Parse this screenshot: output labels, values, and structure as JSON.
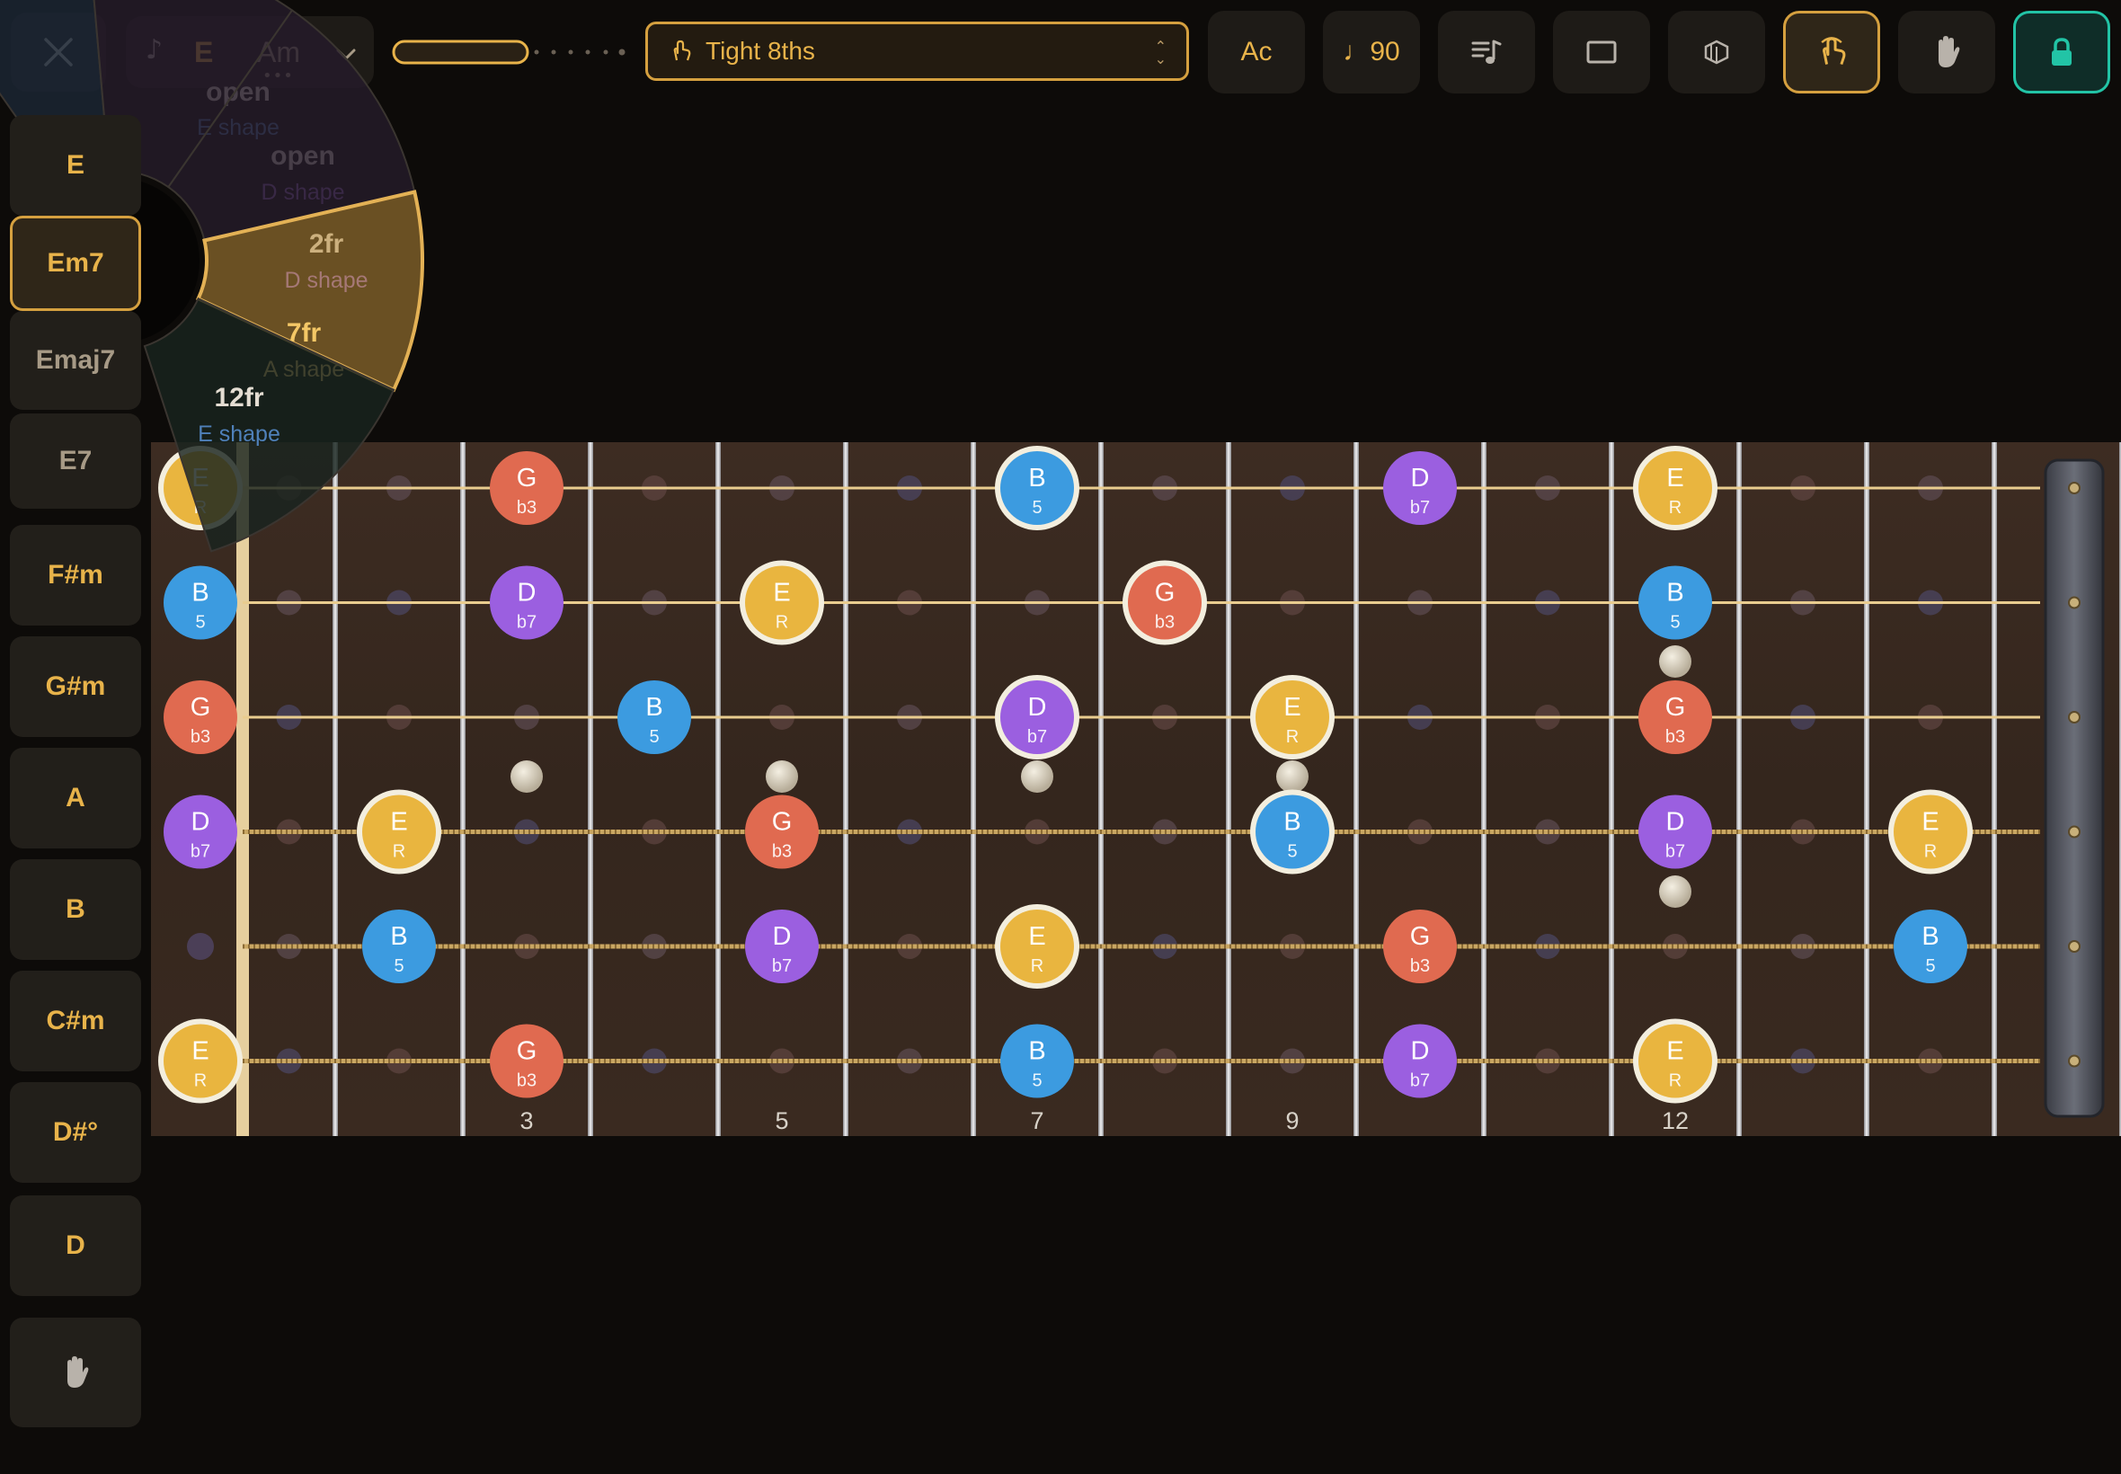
{
  "toolbar": {
    "close_icon": "close-icon",
    "key_note_icon": "music-note-icon",
    "key_root": "E",
    "key_alt": "Am",
    "key_more": "•••",
    "tempo_progress": 0.62,
    "pattern_label": "Tight 8ths",
    "pattern_icon": "tap-icon",
    "ac_label": "Ac",
    "bpm_label": "♩90",
    "buttons": [
      {
        "name": "notation-button",
        "icon": "notation-icon"
      },
      {
        "name": "frame-button",
        "icon": "frame-icon"
      },
      {
        "name": "layers-button",
        "icon": "layers-icon"
      },
      {
        "name": "tap-mode-button",
        "icon": "tap-icon",
        "active": true
      },
      {
        "name": "hand-mode-button",
        "icon": "hand-icon"
      },
      {
        "name": "lock-button",
        "icon": "lock-icon",
        "accent": "#22c4a6"
      }
    ]
  },
  "chords": [
    {
      "label": "E",
      "selected": false
    },
    {
      "label": "Em7",
      "selected": true
    },
    {
      "label": "Emaj7",
      "selected": false
    },
    {
      "label": "E7",
      "selected": false
    },
    {
      "label": "F#m",
      "selected": false
    },
    {
      "label": "G#m",
      "selected": false
    },
    {
      "label": "A",
      "selected": false
    },
    {
      "label": "B",
      "selected": false
    },
    {
      "label": "C#m",
      "selected": false
    },
    {
      "label": "D#°",
      "selected": false
    },
    {
      "label": "D",
      "selected": false
    }
  ],
  "chord_hand_icon": "hand-icon",
  "voicing_menu": [
    {
      "position": "open",
      "shape": "E shape",
      "selected": false
    },
    {
      "position": "open",
      "shape": "D shape",
      "selected": false
    },
    {
      "position": "2fr",
      "shape": "D shape",
      "selected": false
    },
    {
      "position": "7fr",
      "shape": "A shape",
      "selected": true
    },
    {
      "position": "12fr",
      "shape": "E shape",
      "selected": false
    }
  ],
  "fret_markers": [
    "3",
    "5",
    "7",
    "9",
    "12"
  ],
  "colors": {
    "R": "#e9b53f",
    "b3": "#e06a50",
    "5": "#3c9be0",
    "b7": "#9b5fe0",
    "accent": "#d5a03f"
  },
  "notes": [
    {
      "s": 1,
      "f": 0,
      "n": "E",
      "i": "R",
      "o": true
    },
    {
      "s": 1,
      "f": 3,
      "n": "G",
      "i": "b3"
    },
    {
      "s": 1,
      "f": 7,
      "n": "B",
      "i": "5",
      "o": true
    },
    {
      "s": 1,
      "f": 10,
      "n": "D",
      "i": "b7"
    },
    {
      "s": 1,
      "f": 12,
      "n": "E",
      "i": "R",
      "o": true
    },
    {
      "s": 2,
      "f": 0,
      "n": "B",
      "i": "5"
    },
    {
      "s": 2,
      "f": 3,
      "n": "D",
      "i": "b7"
    },
    {
      "s": 2,
      "f": 5,
      "n": "E",
      "i": "R",
      "o": true
    },
    {
      "s": 2,
      "f": 8,
      "n": "G",
      "i": "b3",
      "o": true
    },
    {
      "s": 2,
      "f": 12,
      "n": "B",
      "i": "5"
    },
    {
      "s": 3,
      "f": 0,
      "n": "G",
      "i": "b3"
    },
    {
      "s": 3,
      "f": 4,
      "n": "B",
      "i": "5"
    },
    {
      "s": 3,
      "f": 7,
      "n": "D",
      "i": "b7",
      "o": true
    },
    {
      "s": 3,
      "f": 9,
      "n": "E",
      "i": "R",
      "o": true
    },
    {
      "s": 3,
      "f": 12,
      "n": "G",
      "i": "b3"
    },
    {
      "s": 4,
      "f": 0,
      "n": "D",
      "i": "b7"
    },
    {
      "s": 4,
      "f": 2,
      "n": "E",
      "i": "R",
      "o": true
    },
    {
      "s": 4,
      "f": 5,
      "n": "G",
      "i": "b3"
    },
    {
      "s": 4,
      "f": 9,
      "n": "B",
      "i": "5",
      "o": true
    },
    {
      "s": 4,
      "f": 12,
      "n": "D",
      "i": "b7"
    },
    {
      "s": 4,
      "f": 14,
      "n": "E",
      "i": "R",
      "o": true
    },
    {
      "s": 5,
      "f": 2,
      "n": "B",
      "i": "5"
    },
    {
      "s": 5,
      "f": 5,
      "n": "D",
      "i": "b7"
    },
    {
      "s": 5,
      "f": 7,
      "n": "E",
      "i": "R",
      "o": true
    },
    {
      "s": 5,
      "f": 10,
      "n": "G",
      "i": "b3"
    },
    {
      "s": 5,
      "f": 14,
      "n": "B",
      "i": "5"
    },
    {
      "s": 6,
      "f": 0,
      "n": "E",
      "i": "R",
      "o": true
    },
    {
      "s": 6,
      "f": 3,
      "n": "G",
      "i": "b3"
    },
    {
      "s": 6,
      "f": 7,
      "n": "B",
      "i": "5"
    },
    {
      "s": 6,
      "f": 10,
      "n": "D",
      "i": "b7"
    },
    {
      "s": 6,
      "f": 12,
      "n": "E",
      "i": "R",
      "o": true
    }
  ]
}
